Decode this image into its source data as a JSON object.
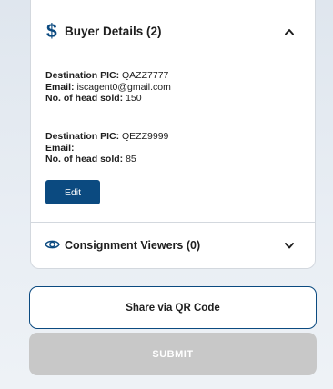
{
  "buyer_section": {
    "icon": "dollar-icon",
    "title": "Buyer Details (2)",
    "expanded": true,
    "buyers": [
      {
        "pic_label": "Destination PIC:",
        "pic_value": "QAZZ7777",
        "email_label": "Email:",
        "email_value": "iscagent0@gmail.com",
        "head_label": "No. of head sold:",
        "head_value": "150"
      },
      {
        "pic_label": "Destination PIC:",
        "pic_value": "QEZZ9999",
        "email_label": "Email:",
        "email_value": "",
        "head_label": "No. of head sold:",
        "head_value": "85"
      }
    ],
    "edit_label": "Edit"
  },
  "viewers_section": {
    "icon": "eye-icon",
    "title": "Consignment Viewers (0)",
    "expanded": false
  },
  "actions": {
    "share_label": "Share via QR Code",
    "submit_label": "SUBMIT",
    "submit_enabled": false
  },
  "colors": {
    "primary": "#0b4a80",
    "disabled": "#c8c8c8"
  }
}
